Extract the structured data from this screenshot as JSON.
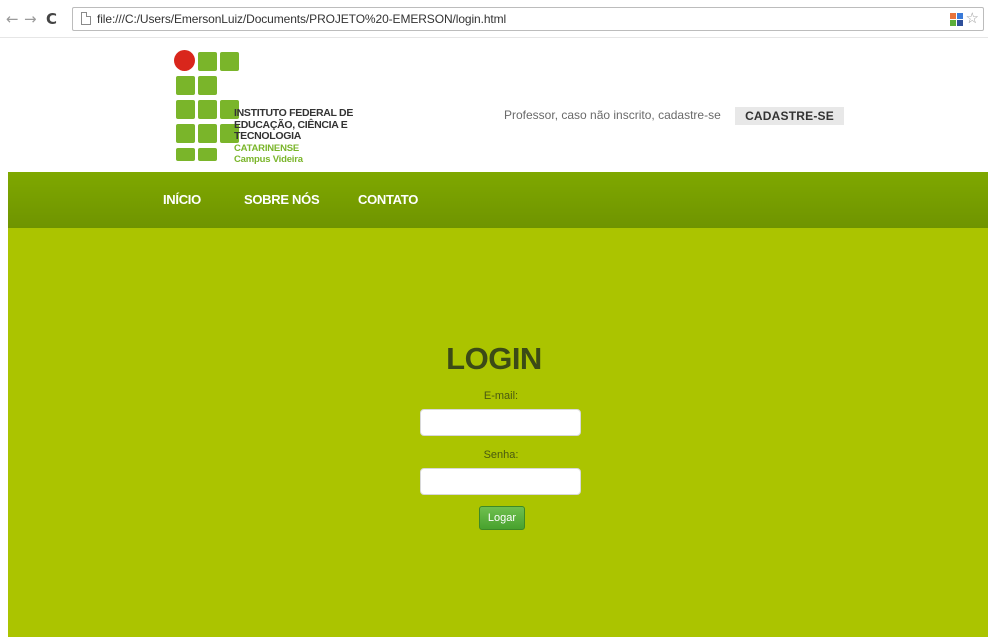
{
  "browser": {
    "back_icon": "←",
    "forward_icon": "→",
    "reload_icon": "C",
    "url": "file:///C:/Users/EmersonLuiz/Documents/PROJETO%20-EMERSON/login.html",
    "star_icon": "☆"
  },
  "header": {
    "logo": {
      "line1": "INSTITUTO FEDERAL DE",
      "line2": "EDUCAÇÃO, CIÊNCIA E TECNOLOGIA",
      "line3": "CATARINENSE",
      "line4": "Campus Videira",
      "colors": {
        "green": "#7ab52a",
        "red": "#d9261c"
      }
    },
    "cadastro_text": "Professor, caso não inscrito, cadastre-se",
    "cadastro_button": "CADASTRE-SE"
  },
  "nav": {
    "items": [
      {
        "label": "INÍCIO"
      },
      {
        "label": "SOBRE NÓS"
      },
      {
        "label": "CONTATO"
      }
    ],
    "color": "#7a9f00"
  },
  "login": {
    "title": "LOGIN",
    "email_label": "E-mail:",
    "email_value": "",
    "senha_label": "Senha:",
    "senha_value": "",
    "submit_label": "Logar",
    "background": "#abc400"
  }
}
